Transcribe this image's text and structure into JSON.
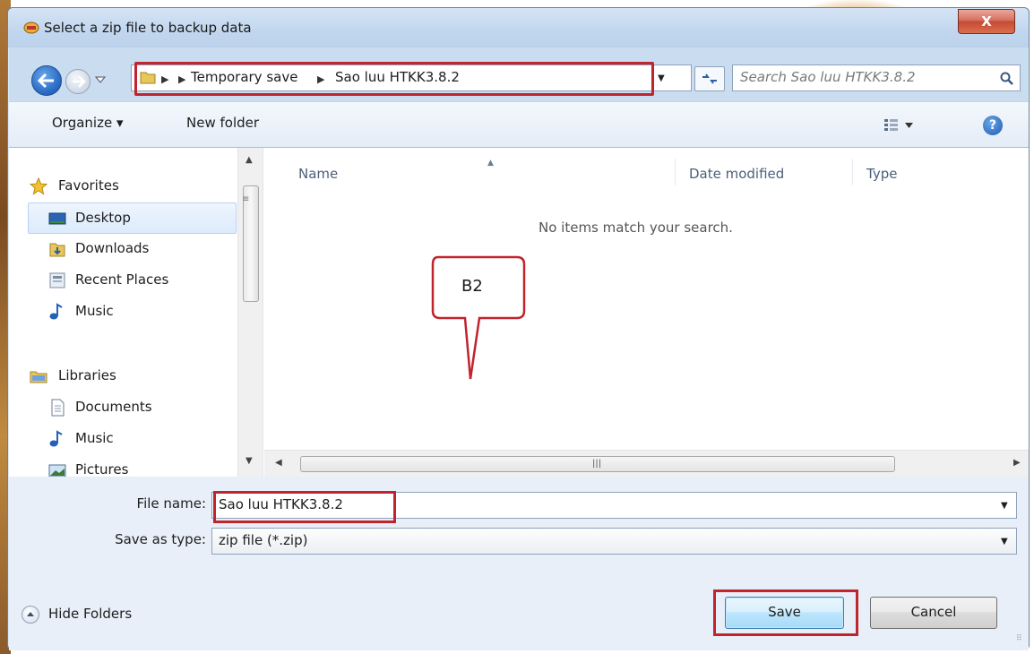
{
  "window": {
    "title": "Select a zip file to backup data",
    "close_symbol": "X"
  },
  "address_bar": {
    "crumbs": [
      "Temporary save",
      "Sao luu HTKK3.8.2"
    ],
    "separator": "▶"
  },
  "search": {
    "placeholder": "Search Sao luu HTKK3.8.2"
  },
  "toolbar": {
    "organize_label": "Organize ▾",
    "new_folder_label": "New folder",
    "help_symbol": "?"
  },
  "nav_pane": {
    "items": [
      {
        "label": "Favorites",
        "icon": "star-icon"
      },
      {
        "label": "Desktop",
        "icon": "desktop-icon"
      },
      {
        "label": "Downloads",
        "icon": "downloads-icon"
      },
      {
        "label": "Recent Places",
        "icon": "recent-places-icon"
      },
      {
        "label": "Music",
        "icon": "music-icon"
      },
      {
        "label": "Libraries",
        "icon": "libraries-icon"
      },
      {
        "label": "Documents",
        "icon": "documents-icon"
      },
      {
        "label": "Music",
        "icon": "music-icon"
      },
      {
        "label": "Pictures",
        "icon": "pictures-icon"
      }
    ],
    "selected": "Desktop"
  },
  "file_list": {
    "columns": [
      "Name",
      "Date modified",
      "Type"
    ],
    "empty_message": "No items match your search."
  },
  "annotation": {
    "callout_label": "B2"
  },
  "form": {
    "file_name_label": "File name:",
    "file_name_value": "Sao luu HTKK3.8.2",
    "save_as_type_label": "Save as type:",
    "save_as_type_value": "zip file (*.zip)"
  },
  "footer": {
    "hide_folders_label": "Hide Folders",
    "save_label": "Save",
    "cancel_label": "Cancel"
  },
  "colors": {
    "highlight": "#c0242d",
    "window_frame": "#c9dcf0"
  }
}
